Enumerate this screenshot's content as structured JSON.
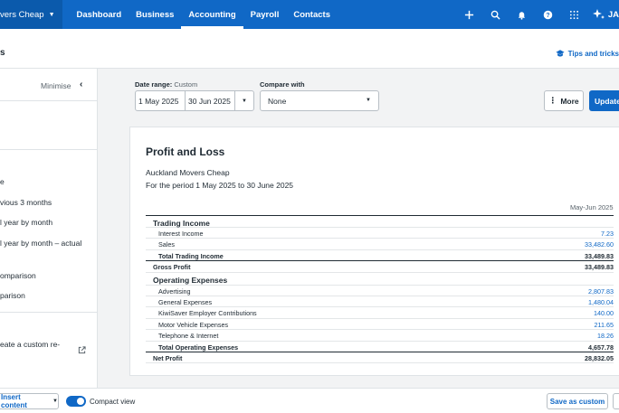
{
  "topnav": {
    "org_name": "vers Cheap",
    "links": [
      "Dashboard",
      "Business",
      "Accounting",
      "Payroll",
      "Contacts"
    ],
    "active": "Accounting",
    "user_initials": "JA"
  },
  "header": {
    "title": "s",
    "tips": "Tips and tricks"
  },
  "sidebar": {
    "minimise": "Minimise",
    "items": [
      "e",
      "vious 3 months",
      "l year by month",
      "l year by month – actual",
      "omparison",
      "parison",
      "eate a custom re-"
    ]
  },
  "toolbar": {
    "date_range_label": "Date range:",
    "date_range_mode": "Custom",
    "date_from": "1 May 2025",
    "date_to": "30 Jun 2025",
    "compare_label": "Compare with",
    "compare_value": "None",
    "more": "More",
    "update": "Update"
  },
  "report": {
    "title": "Profit and Loss",
    "org": "Auckland Movers Cheap",
    "period": "For the period 1 May 2025 to 30 June 2025",
    "column": "May-Jun 2025",
    "trading_income": {
      "heading": "Trading Income",
      "rows": [
        {
          "label": "Interest Income",
          "value": "7.23"
        },
        {
          "label": "Sales",
          "value": "33,482.60"
        }
      ],
      "total_label": "Total Trading Income",
      "total_value": "33,489.83"
    },
    "gross_profit": {
      "label": "Gross Profit",
      "value": "33,489.83"
    },
    "operating_expenses": {
      "heading": "Operating Expenses",
      "rows": [
        {
          "label": "Advertising",
          "value": "2,807.83"
        },
        {
          "label": "General Expenses",
          "value": "1,480.04"
        },
        {
          "label": "KiwiSaver Employer Contributions",
          "value": "140.00"
        },
        {
          "label": "Motor Vehicle Expenses",
          "value": "211.65"
        },
        {
          "label": "Telephone & Internet",
          "value": "18.26"
        }
      ],
      "total_label": "Total Operating Expenses",
      "total_value": "4,657.78"
    },
    "net_profit": {
      "label": "Net Profit",
      "value": "28,832.05"
    }
  },
  "bottombar": {
    "insert": "Insert content",
    "compact": "Compact view",
    "save_as": "Save as custom"
  },
  "colors": {
    "brand": "#1068c6",
    "nav_dark": "#0b5aac",
    "text": "#1f2a33"
  }
}
